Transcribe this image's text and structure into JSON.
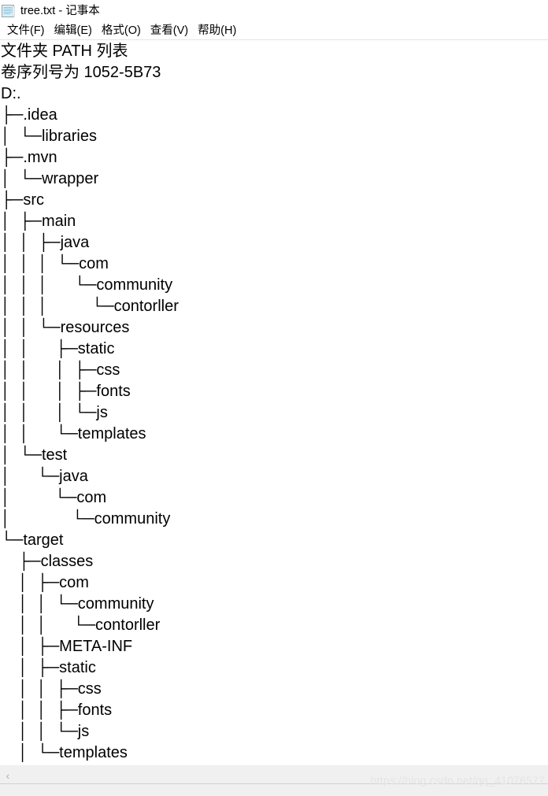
{
  "window": {
    "icon": "notepad-document-icon",
    "title": "tree.txt - 记事本"
  },
  "menubar": {
    "items": [
      {
        "label": "文件(F)"
      },
      {
        "label": "编辑(E)"
      },
      {
        "label": "格式(O)"
      },
      {
        "label": "查看(V)"
      },
      {
        "label": "帮助(H)"
      }
    ]
  },
  "document": {
    "lines": [
      "文件夹 PATH 列表",
      "卷序列号为 1052-5B73",
      "D:.",
      "├─.idea",
      "│  └─libraries",
      "├─.mvn",
      "│  └─wrapper",
      "├─src",
      "│  ├─main",
      "│  │  ├─java",
      "│  │  │  └─com",
      "│  │  │      └─community",
      "│  │  │          └─contorller",
      "│  │  └─resources",
      "│  │      ├─static",
      "│  │      │  ├─css",
      "│  │      │  ├─fonts",
      "│  │      │  └─js",
      "│  │      └─templates",
      "│  └─test",
      "│      └─java",
      "│          └─com",
      "│              └─community",
      "└─target",
      "    ├─classes",
      "    │  ├─com",
      "    │  │  └─community",
      "    │  │      └─contorller",
      "    │  ├─META-INF",
      "    │  ├─static",
      "    │  │  ├─css",
      "    │  │  ├─fonts",
      "    │  │  └─js",
      "    │  └─templates"
    ]
  },
  "scrollbar": {
    "left_arrow": "‹",
    "orientation": "horizontal"
  },
  "watermark": {
    "text": "https://blog.csdn.net/qq_41076577"
  },
  "colors": {
    "window_background": "#ffffff",
    "text": "#000000",
    "scrollbar_background": "#f0f0f0",
    "watermark": "#e4e4e4"
  }
}
